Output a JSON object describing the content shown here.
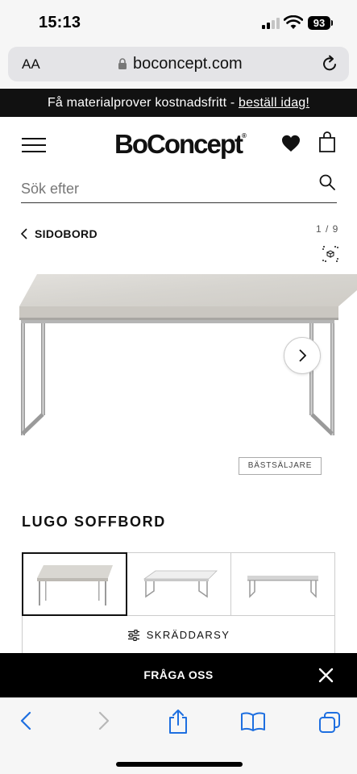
{
  "status_bar": {
    "time": "15:13",
    "battery": "93"
  },
  "browser": {
    "text_size_label": "AA",
    "url": "boconcept.com"
  },
  "promo": {
    "text": "Få materialprover kostnadsfritt - ",
    "link": "beställ idag!"
  },
  "header": {
    "logo": "BoConcept",
    "logo_mark": "®"
  },
  "search": {
    "placeholder": "Sök efter"
  },
  "breadcrumb": {
    "label": "SIDOBORD"
  },
  "gallery": {
    "pager": "1 / 9"
  },
  "badge": "BÄSTSÄLJARE",
  "product": {
    "title": "LUGO SOFFBORD"
  },
  "customize_label": "SKRÄDDARSY",
  "ask_label": "FRÅGA OSS",
  "colors": {
    "dark": "#111111",
    "url_bar": "#e4e4e7",
    "accent_ios": "#1e6fe0",
    "marble": "#dcdad5",
    "steel": "#9c9c9c"
  }
}
